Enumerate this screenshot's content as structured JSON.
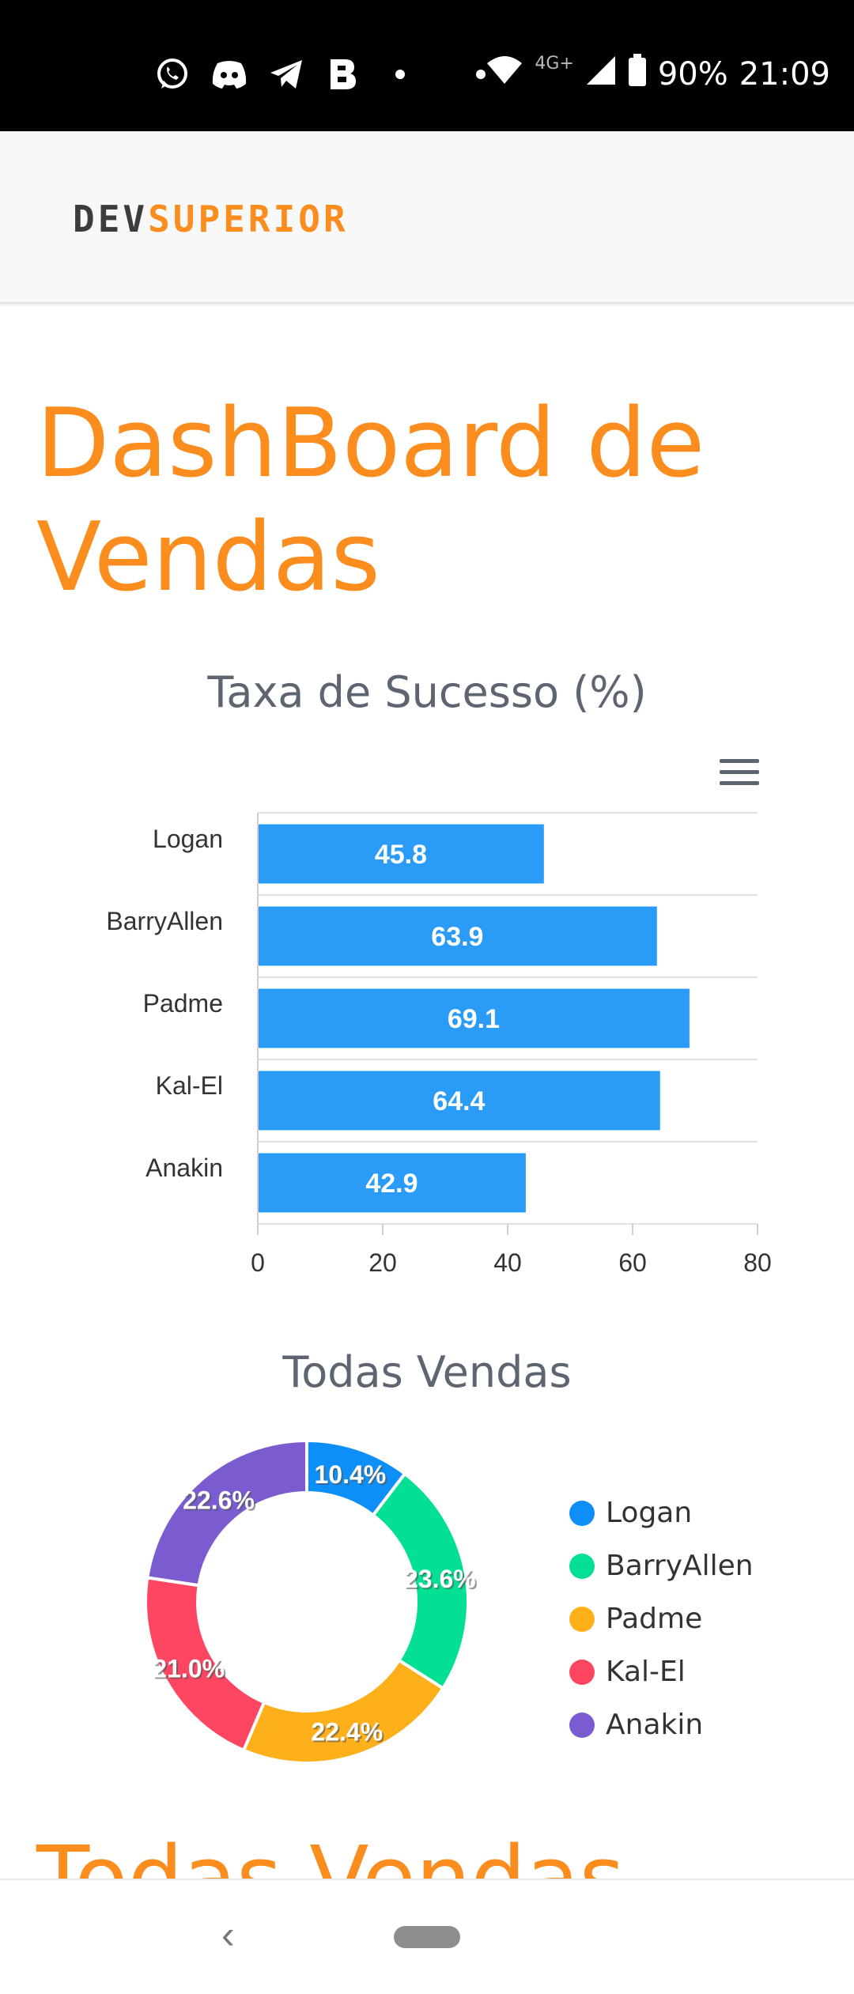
{
  "status_bar": {
    "network": "4G+",
    "battery": "90%",
    "time": "21:09"
  },
  "navbar": {
    "logo_part1": "DEV",
    "logo_part2": "SUPERIOR"
  },
  "page_title": "DashBoard de Vendas",
  "bar_chart_title": "Taxa de Sucesso (%)",
  "donut_chart_title": "Todas Vendas",
  "section_title": "Todas Vendas",
  "colors": {
    "accent": "#fb8c1e",
    "bar": "#2a9cf8",
    "title_gray": "#5d6570"
  },
  "chart_data": [
    {
      "type": "bar",
      "orientation": "horizontal",
      "title": "Taxa de Sucesso (%)",
      "categories": [
        "Logan",
        "BarryAllen",
        "Padme",
        "Kal-El",
        "Anakin"
      ],
      "values": [
        45.8,
        63.9,
        69.1,
        64.4,
        42.9
      ],
      "data_labels": [
        "45.8",
        "63.9",
        "69.1",
        "64.4",
        "42.9"
      ],
      "xlim": [
        0,
        80
      ],
      "ticks": [
        0,
        20,
        40,
        60,
        80
      ],
      "grid": true,
      "color": "#2a9cf8"
    },
    {
      "type": "pie",
      "donut": true,
      "title": "Todas Vendas",
      "labels": [
        "Logan",
        "BarryAllen",
        "Padme",
        "Kal-El",
        "Anakin"
      ],
      "values": [
        10.4,
        23.6,
        22.4,
        21.0,
        22.6
      ],
      "data_labels": [
        "10.4%",
        "23.6%",
        "22.4%",
        "21.0%",
        "22.6%"
      ],
      "colors": [
        "#0d8ff7",
        "#03e093",
        "#feb01a",
        "#fe4561",
        "#7a5cd0"
      ],
      "legend_position": "right"
    }
  ]
}
